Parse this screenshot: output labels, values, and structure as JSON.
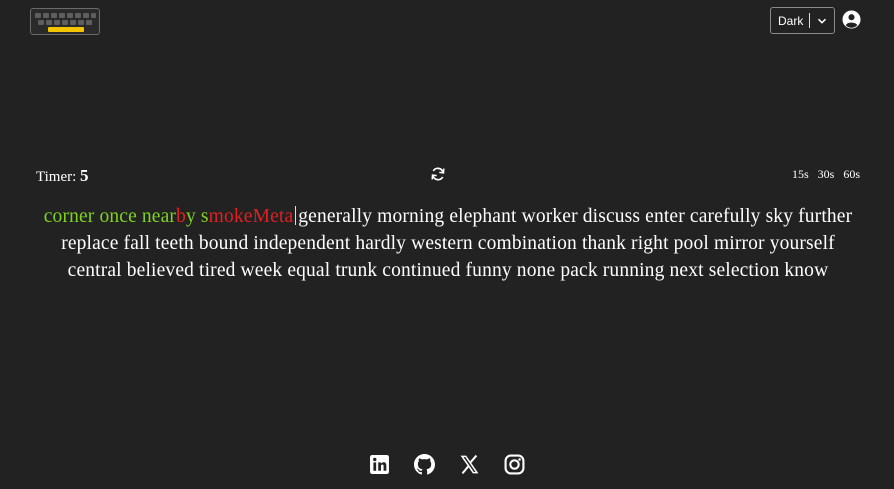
{
  "header": {
    "theme": {
      "selected": "Dark"
    }
  },
  "controls": {
    "timer_label": "Timer:",
    "timer_value": "5",
    "durations": [
      "15s",
      "30s",
      "60s"
    ]
  },
  "typing": {
    "typed": [
      {
        "text": "corner once near",
        "status": "correct"
      },
      {
        "text": "by",
        "status": "mixed"
      },
      {
        "text": " s",
        "status": "correct"
      },
      {
        "text": "moke",
        "status": "incorrect"
      },
      {
        "text": "Meta",
        "status": "incorrect"
      }
    ],
    "remaining": "generally morning elephant worker discuss enter carefully sky further replace fall teeth bound independent hardly western combination thank right pool mirror yourself central believed tired week equal trunk continued funny none pack running next selection know"
  },
  "footer": {
    "socials": [
      "linkedin-icon",
      "github-icon",
      "x-icon",
      "instagram-icon"
    ]
  },
  "colors": {
    "background": "#222222",
    "correct": "#7ed321",
    "incorrect": "#e02020",
    "text": "#ffffff"
  }
}
